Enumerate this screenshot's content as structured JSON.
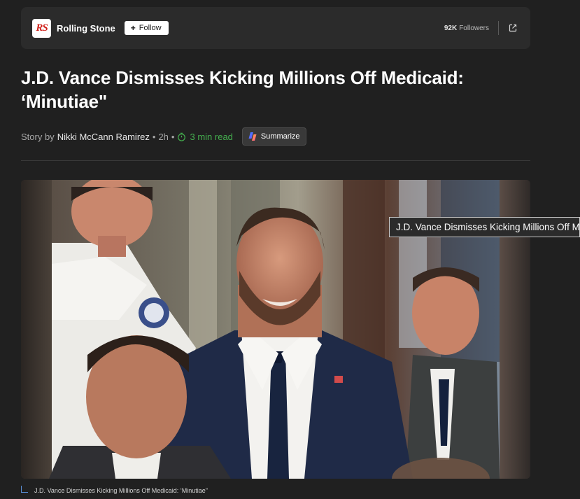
{
  "publisher": {
    "logo_text": "RS",
    "name": "Rolling Stone",
    "follow_label": "Follow",
    "followers_count": "92K",
    "followers_label": "Followers"
  },
  "article": {
    "title": "J.D. Vance Dismisses Kicking Millions Off Medicaid: ‘Minutiae\"",
    "byline_prefix": "Story by",
    "author": "Nikki McCann Ramirez",
    "age": "2h",
    "read_time": "3 min read",
    "summarize_label": "Summarize"
  },
  "image": {
    "tooltip": "J.D. Vance Dismisses Kicking Millions Off Medicaid: ‘Minutiae\"",
    "caption": "J.D. Vance Dismisses Kicking Millions Off Medicaid: ‘Minutiae\""
  },
  "icons": {
    "follow": "plus-icon",
    "share": "open-external-icon",
    "read_time": "timer-icon",
    "summarize": "copilot-icon"
  },
  "colors": {
    "background": "#202020",
    "card": "#2b2b2b",
    "read_time_green": "#45b04f",
    "logo_red": "#d0201a"
  }
}
